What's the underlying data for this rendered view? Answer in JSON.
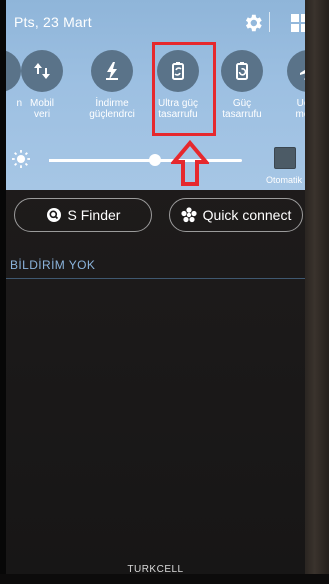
{
  "status": {
    "date": "Pts, 23 Mart"
  },
  "quick_panel": {
    "toggles": [
      {
        "label": "n",
        "icon": "partial-toggle-icon"
      },
      {
        "label": "Mobil\nveri",
        "icon": "mobile-data-icon"
      },
      {
        "label": "İndirme\ngüçlendrci",
        "icon": "download-booster-icon"
      },
      {
        "label": "Ultra güç\ntasarrufu",
        "icon": "ultra-power-saving-icon"
      },
      {
        "label": "Güç\ntasarrufu",
        "icon": "power-saving-icon"
      },
      {
        "label": "Uçuş\nmodu",
        "icon": "airplane-icon"
      }
    ],
    "brightness": {
      "level": 0.55,
      "auto_label": "Otomatik"
    }
  },
  "actions": {
    "s_finder": "S Finder",
    "quick_connect": "Quick connect"
  },
  "notifications": {
    "empty_title": "BİLDİRİM YOK"
  },
  "footer": {
    "carrier": "TURKCELL"
  },
  "colors": {
    "highlight": "#e6282d",
    "panel": "#9dc0e2",
    "accent_text": "#8bb4dc"
  }
}
